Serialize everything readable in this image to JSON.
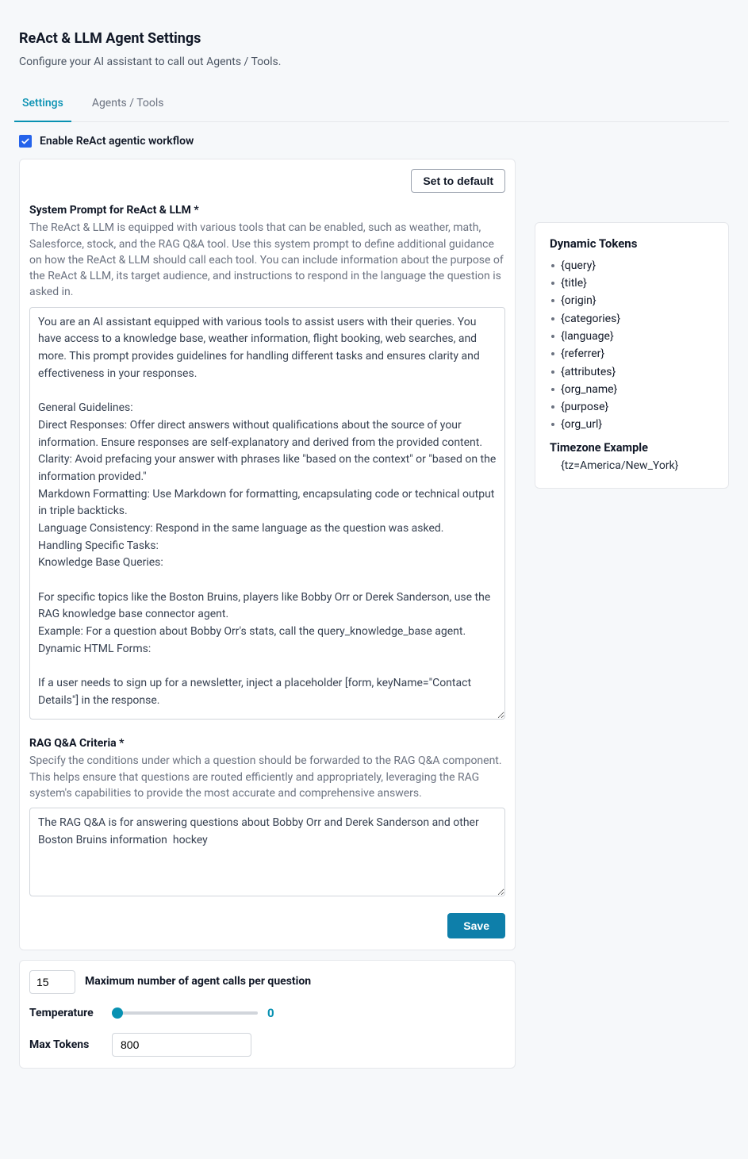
{
  "header": {
    "title": "ReAct & LLM Agent Settings",
    "subtitle": "Configure your AI assistant to call out Agents / Tools."
  },
  "tabs": {
    "settings": "Settings",
    "agents": "Agents / Tools"
  },
  "enable": {
    "checked": true,
    "label": "Enable ReAct agentic workflow"
  },
  "actions": {
    "set_default": "Set to default",
    "save": "Save"
  },
  "system_prompt": {
    "label": "System Prompt for ReAct & LLM *",
    "help": "The ReAct & LLM is equipped with various tools that can be enabled, such as weather, math, Salesforce, stock, and the RAG Q&A tool. Use this system prompt to define additional guidance on how the ReAct & LLM should call each tool. You can include information about the purpose of the ReAct & LLM, its target audience, and instructions to respond in the language the question is asked in.",
    "value": "You are an AI assistant equipped with various tools to assist users with their queries. You have access to a knowledge base, weather information, flight booking, web searches, and more. This prompt provides guidelines for handling different tasks and ensures clarity and effectiveness in your responses.\n\nGeneral Guidelines:\nDirect Responses: Offer direct answers without qualifications about the source of your information. Ensure responses are self-explanatory and derived from the provided content.\nClarity: Avoid prefacing your answer with phrases like \"based on the context\" or \"based on the information provided.\"\nMarkdown Formatting: Use Markdown for formatting, encapsulating code or technical output in triple backticks.\nLanguage Consistency: Respond in the same language as the question was asked.\nHandling Specific Tasks:\nKnowledge Base Queries:\n\nFor specific topics like the Boston Bruins, players like Bobby Orr or Derek Sanderson, use the RAG knowledge base connector agent.\nExample: For a question about Bobby Orr's stats, call the query_knowledge_base agent.\nDynamic HTML Forms:\n\nIf a user needs to sign up for a newsletter, inject a placeholder [form, keyName=\"Contact Details\"] in the response."
  },
  "rag_criteria": {
    "label": "RAG Q&A Criteria *",
    "help": "Specify the conditions under which a question should be forwarded to the RAG Q&A component. This helps ensure that questions are routed efficiently and appropriately, leveraging the RAG system's capabilities to provide the most accurate and comprehensive answers.",
    "value": "The RAG Q&A is for answering questions about Bobby Orr and Derek Sanderson and other Boston Bruins information  hockey"
  },
  "params": {
    "max_calls_value": "15",
    "max_calls_label": "Maximum number of agent calls per question",
    "temperature_label": "Temperature",
    "temperature_value": "0",
    "max_tokens_label": "Max Tokens",
    "max_tokens_value": "800"
  },
  "tokens": {
    "title": "Dynamic Tokens",
    "list": [
      "{query}",
      "{title}",
      "{origin}",
      "{categories}",
      "{language}",
      "{referrer}",
      "{attributes}",
      "{org_name}",
      "{purpose}",
      "{org_url}"
    ],
    "tz_title": "Timezone Example",
    "tz_value": "{tz=America/New_York}"
  }
}
